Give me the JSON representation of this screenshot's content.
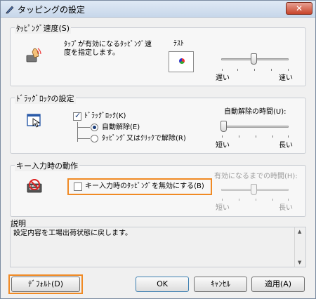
{
  "window": {
    "title": "タッピングの設定",
    "close_label": "✕"
  },
  "tap_speed": {
    "group_title": "ﾀｯﾋﾟﾝｸﾞ速度(S)",
    "description": "ﾀｯﾌﾟが有効になるﾀｯﾋﾟﾝｸﾞ速度を指定します。",
    "test_label": "ﾃｽﾄ",
    "slow_label": "遅い",
    "fast_label": "速い",
    "slider_value": 0.5
  },
  "drag_lock": {
    "group_title": "ﾄﾞﾗｯｸﾞﾛｯｸの設定",
    "checkbox_label": "ﾄﾞﾗｯｸﾞﾛｯｸ(K)",
    "checked": true,
    "radio_auto_label": "自動解除(E)",
    "radio_tap_label": "ﾀｯﾋﾟﾝｸﾞ又はｸﾘｯｸで解除(R)",
    "release_time_label": "自動解除の時間(U):",
    "short_label": "短い",
    "long_label": "長い",
    "slider_value": 0.0
  },
  "key_input": {
    "group_title": "キー入力時の動作",
    "checkbox_label": "キー入力時のﾀｯﾋﾟﾝｸﾞを無効にする(B)",
    "checked": false,
    "enable_time_label": "有効になるまでの時間(H):",
    "short_label": "短い",
    "long_label": "長い",
    "slider_value": 0.5
  },
  "description": {
    "group_title": "説明",
    "text": "設定内容を工場出荷状態に戻します。"
  },
  "buttons": {
    "default_label": "ﾃﾞﾌｫﾙﾄ(D)",
    "ok_label": "OK",
    "cancel_label": "ｷｬﾝｾﾙ",
    "apply_label": "適用(A)"
  },
  "colors": {
    "highlight": "#f08a24",
    "accent": "#1a3d7a"
  }
}
